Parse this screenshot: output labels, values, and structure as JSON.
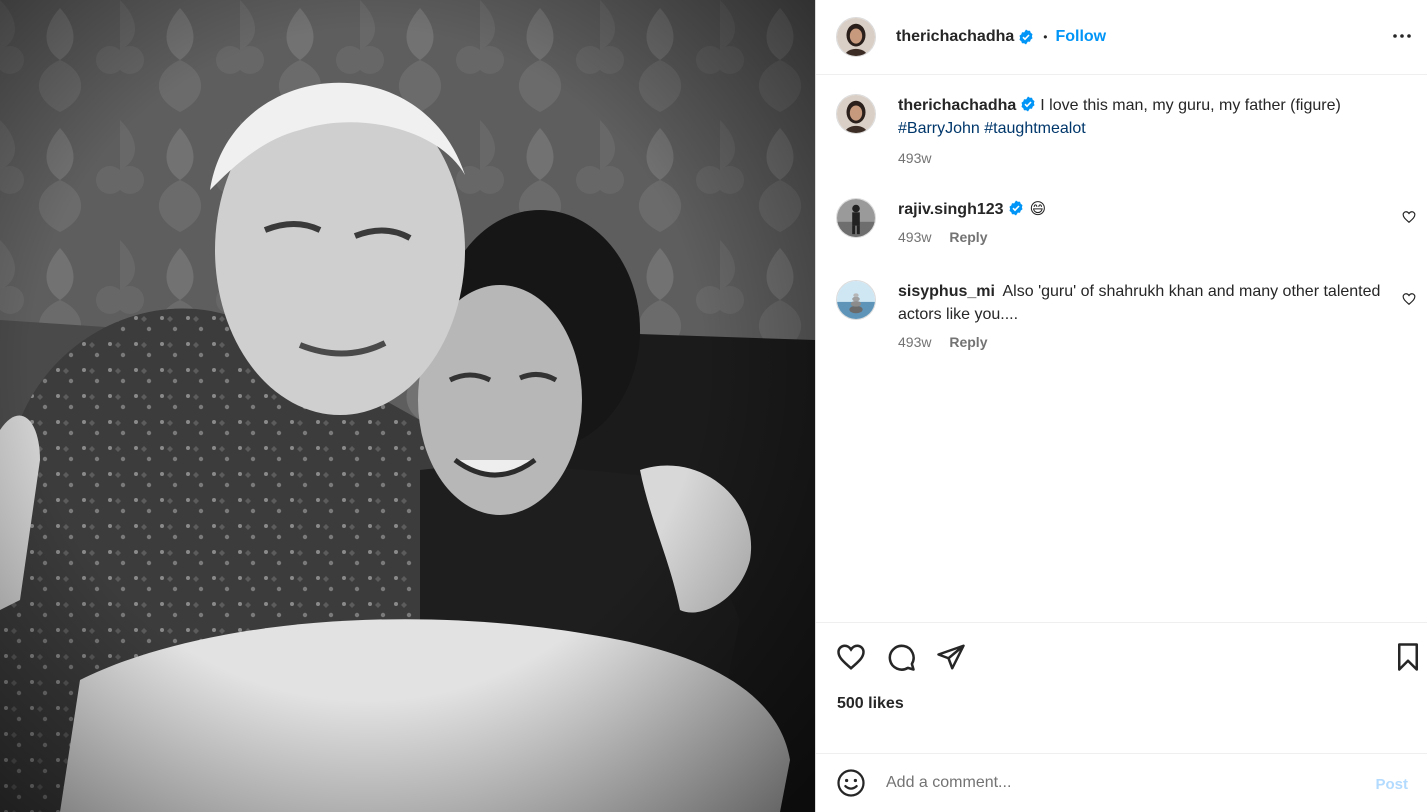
{
  "photo": {
    "alt": "Black and white photo of an older man hugging a smiling woman"
  },
  "header": {
    "username": "therichachadha",
    "separator": "•",
    "follow_label": "Follow",
    "more_icon": "more-horizontal-icon"
  },
  "caption": {
    "username": "therichachadha",
    "text": "I love this man, my guru, my father (figure)",
    "hashtags": [
      "#BarryJohn",
      "#taughtmealot"
    ],
    "time": "493w"
  },
  "comments": [
    {
      "username": "rajiv.singh123",
      "text": "😄",
      "verified": true,
      "time": "493w",
      "reply_label": "Reply"
    },
    {
      "username": "sisyphus_mi",
      "text": "Also 'guru' of shahrukh khan and many other talented actors like you....",
      "verified": false,
      "time": "493w",
      "reply_label": "Reply"
    }
  ],
  "actions": {
    "likes": "500 likes",
    "icons": [
      "heart-icon",
      "comment-icon",
      "share-icon",
      "bookmark-icon"
    ]
  },
  "add_comment": {
    "placeholder": "Add a comment...",
    "post_label": "Post"
  },
  "colors": {
    "link": "#0095f6",
    "hashtag": "#00376b",
    "muted": "#737373",
    "post_disabled": "#b3dbff",
    "verified": "#0095f6"
  }
}
